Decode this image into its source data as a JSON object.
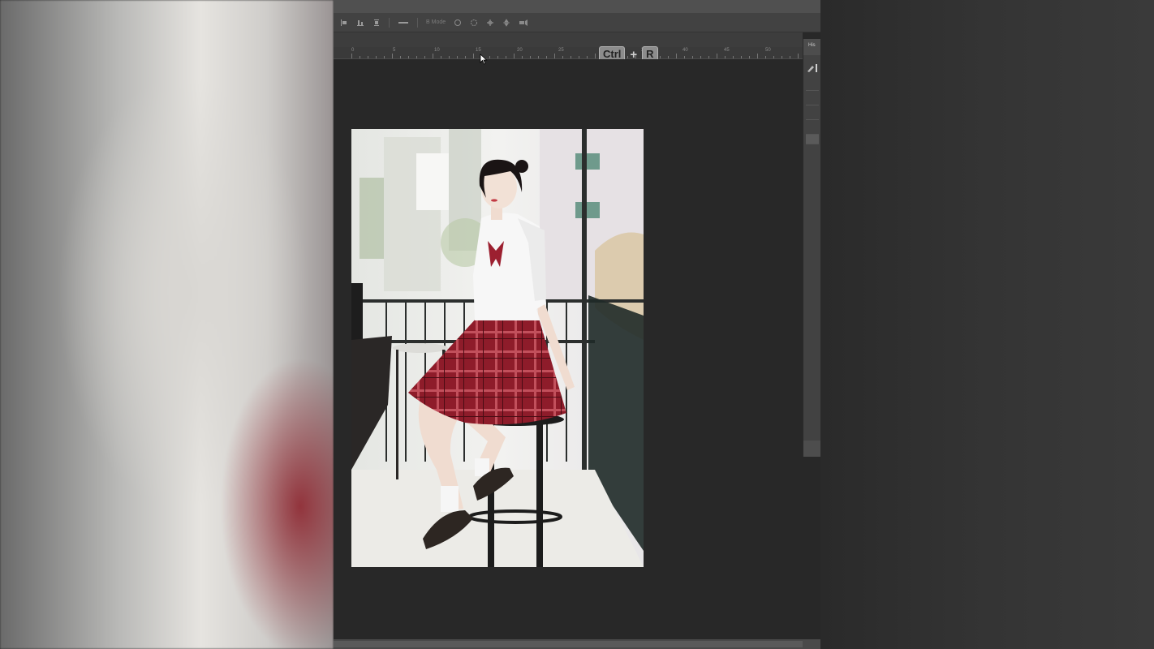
{
  "options_bar": {
    "mode_label": "B Mode",
    "icons": [
      "align-left-icon",
      "align-center-icon",
      "distribute-icon",
      "minus-icon",
      "rotate-3d-icon",
      "orbit-icon",
      "pan-3d-icon",
      "slide-3d-icon",
      "scale-3d-icon"
    ]
  },
  "ruler": {
    "labels": [
      "0",
      "5",
      "10",
      "15",
      "20",
      "25",
      "30",
      "35",
      "40",
      "45",
      "50"
    ]
  },
  "shortcut": {
    "key1": "Ctrl",
    "plus": "+",
    "key2": "R"
  },
  "panel": {
    "title": "His"
  },
  "colors": {
    "workspace": "#282828",
    "options_bar": "#424242",
    "ruler": "#3a3a3a",
    "skirt_red": "#8e1c2a"
  }
}
